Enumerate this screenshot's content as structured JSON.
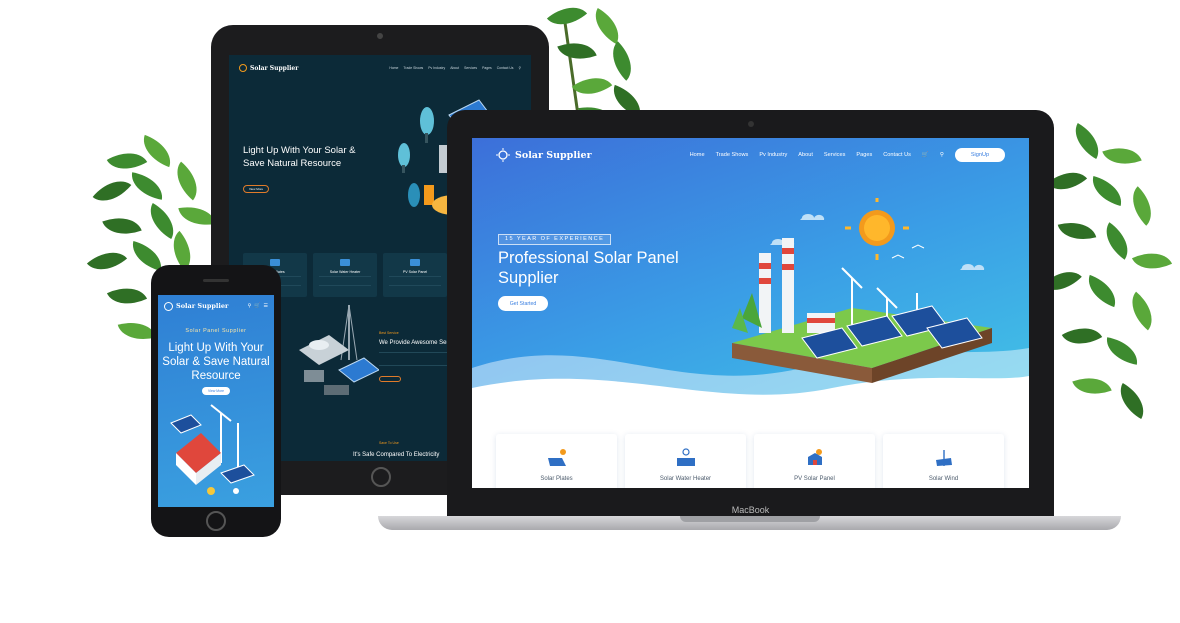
{
  "brand": {
    "name": "Solar Supplier",
    "accent": "#f39a1c",
    "primary": "#3a7fe0"
  },
  "tablet": {
    "nav_items": [
      "Home",
      "Trade Shows",
      "Pv Industry",
      "About",
      "Services",
      "Pages",
      "Contact Us"
    ],
    "hero_title": "Light Up With Your Solar & Save Natural Resource",
    "hero_button": "View More",
    "cards": [
      "Solar Plates",
      "Solar Water Heater",
      "PV Solar Panel"
    ],
    "section_label": "Best Service",
    "section_title": "We Provide Awesome Service",
    "section_button": "View More",
    "save_label": "Save To Use",
    "electricity_title": "It's Safe Compared To Electricity"
  },
  "laptop": {
    "nav_items": [
      "Home",
      "Trade Shows",
      "Pv Industry",
      "About",
      "Services",
      "Pages",
      "Contact Us"
    ],
    "signup": "SignUp",
    "badge": "15 YEAR OF EXPERIENCE",
    "hero_title": "Professional Solar Panel Supplier",
    "hero_button": "Get Started",
    "services": [
      "Solar Plates",
      "Solar Water Heater",
      "PV Solar Panel",
      "Solar Wind"
    ],
    "device_label": "MacBook"
  },
  "phone": {
    "subtitle": "Solar Panel Supplier",
    "hero_title": "Light Up With Your Solar & Save Natural Resource",
    "hero_button": "View More"
  }
}
